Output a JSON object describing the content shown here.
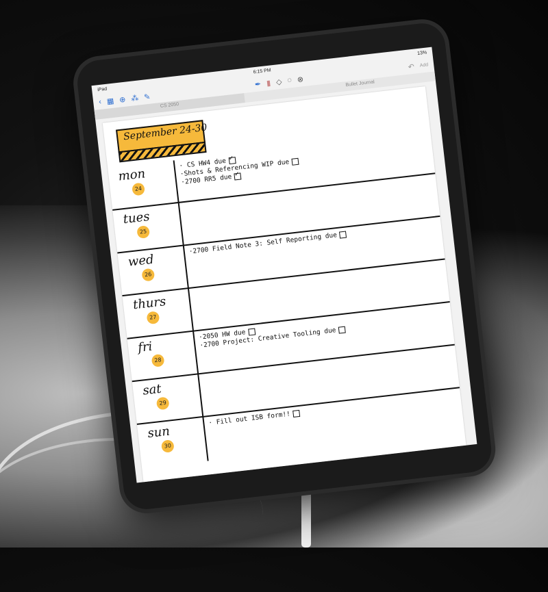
{
  "status_bar": {
    "carrier": "iPad",
    "time": "6:15 PM",
    "battery": "13%"
  },
  "toolbar": {
    "back_icon": "chevron-left-icon",
    "left_icons": [
      "grid-icon",
      "add-icon",
      "shapes-icon",
      "edit-icon"
    ],
    "center_tools": [
      "pen-icon",
      "highlighter-icon",
      "eraser-icon",
      "lasso-icon",
      "close-circle-icon"
    ],
    "undo_icon": "undo-icon",
    "right_label": "Add"
  },
  "tabs": {
    "left": "CS 2050",
    "right": "Bullet Journal"
  },
  "journal": {
    "header": "September 24-30",
    "days": [
      {
        "name": "mon",
        "num": "24",
        "tasks": [
          {
            "text": "· CS HW4 due",
            "checked": true
          },
          {
            "text": "·Shots & Referencing WIP due",
            "checked": false
          },
          {
            "text": "·2700 RR5 due",
            "checked": true
          }
        ]
      },
      {
        "name": "tues",
        "num": "25",
        "tasks": []
      },
      {
        "name": "wed",
        "num": "26",
        "tasks": [
          {
            "text": "·2700 Field Note 3: Self Reporting due",
            "checked": false
          }
        ]
      },
      {
        "name": "thurs",
        "num": "27",
        "tasks": []
      },
      {
        "name": "fri",
        "num": "28",
        "tasks": [
          {
            "text": "·2050 HW due",
            "checked": false
          },
          {
            "text": "·2700 Project: Creative Tooling due",
            "checked": false
          }
        ]
      },
      {
        "name": "sat",
        "num": "29",
        "tasks": []
      },
      {
        "name": "sun",
        "num": "30",
        "tasks": [
          {
            "text": "· Fill out ISB form!!",
            "checked": false
          }
        ]
      }
    ]
  }
}
